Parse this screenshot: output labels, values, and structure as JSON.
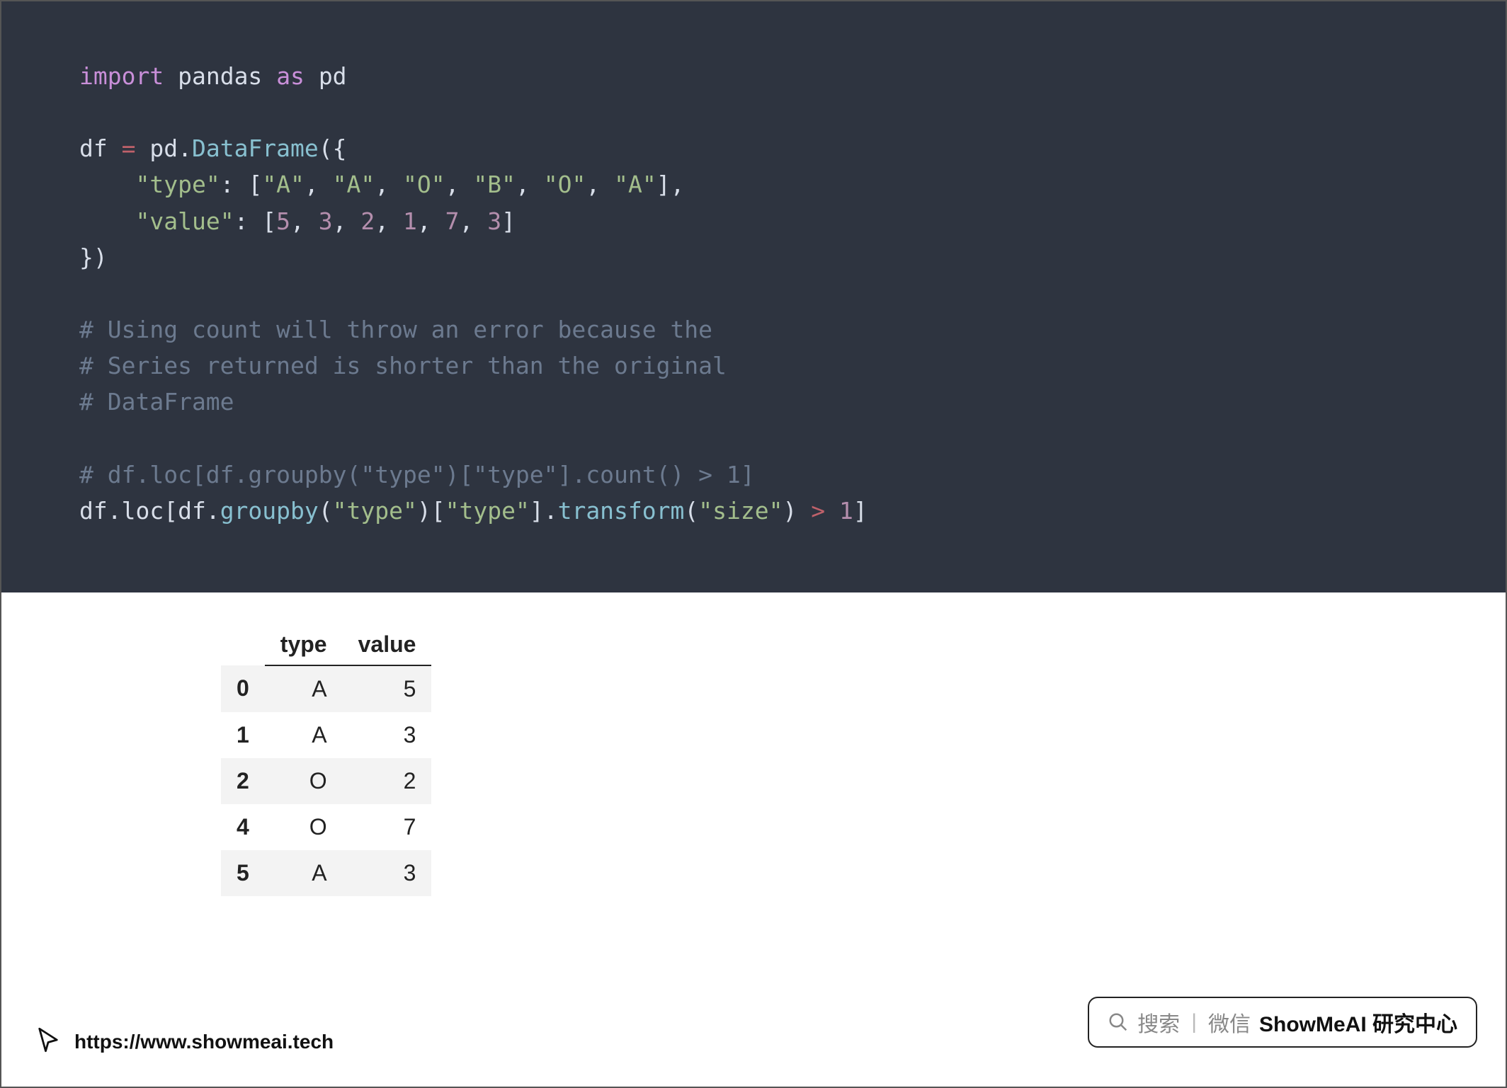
{
  "code": {
    "lines": [
      [
        [
          "import",
          "kw"
        ],
        [
          " ",
          "op"
        ],
        [
          "pandas",
          "attr"
        ],
        [
          " ",
          "op"
        ],
        [
          "as",
          "kw"
        ],
        [
          " ",
          "op"
        ],
        [
          "pd",
          "attr"
        ]
      ],
      [],
      [
        [
          "df ",
          "attr"
        ],
        [
          "=",
          "opred"
        ],
        [
          " pd.",
          "attr"
        ],
        [
          "DataFrame",
          "fn"
        ],
        [
          "({",
          "op"
        ]
      ],
      [
        [
          "    ",
          "op"
        ],
        [
          "\"type\"",
          "str"
        ],
        [
          ": [",
          "op"
        ],
        [
          "\"A\"",
          "str"
        ],
        [
          ", ",
          "op"
        ],
        [
          "\"A\"",
          "str"
        ],
        [
          ", ",
          "op"
        ],
        [
          "\"O\"",
          "str"
        ],
        [
          ", ",
          "op"
        ],
        [
          "\"B\"",
          "str"
        ],
        [
          ", ",
          "op"
        ],
        [
          "\"O\"",
          "str"
        ],
        [
          ", ",
          "op"
        ],
        [
          "\"A\"",
          "str"
        ],
        [
          "],",
          "op"
        ]
      ],
      [
        [
          "    ",
          "op"
        ],
        [
          "\"value\"",
          "str"
        ],
        [
          ": [",
          "op"
        ],
        [
          "5",
          "num"
        ],
        [
          ", ",
          "op"
        ],
        [
          "3",
          "num"
        ],
        [
          ", ",
          "op"
        ],
        [
          "2",
          "num"
        ],
        [
          ", ",
          "op"
        ],
        [
          "1",
          "num"
        ],
        [
          ", ",
          "op"
        ],
        [
          "7",
          "num"
        ],
        [
          ", ",
          "op"
        ],
        [
          "3",
          "num"
        ],
        [
          "]",
          "op"
        ]
      ],
      [
        [
          "})",
          "op"
        ]
      ],
      [],
      [
        [
          "# Using count will throw an error because the",
          "cmt"
        ]
      ],
      [
        [
          "# Series returned is shorter than the original",
          "cmt"
        ]
      ],
      [
        [
          "# DataFrame",
          "cmt"
        ]
      ],
      [],
      [
        [
          "# df.loc[df.groupby(\"type\")[\"type\"].count() > 1]",
          "cmt"
        ]
      ],
      [
        [
          "df.loc[df.",
          "attr"
        ],
        [
          "groupby",
          "fn"
        ],
        [
          "(",
          "op"
        ],
        [
          "\"type\"",
          "str"
        ],
        [
          ")[",
          "op"
        ],
        [
          "\"type\"",
          "str"
        ],
        [
          "].",
          "op"
        ],
        [
          "transform",
          "fn"
        ],
        [
          "(",
          "op"
        ],
        [
          "\"size\"",
          "str"
        ],
        [
          ") ",
          "op"
        ],
        [
          ">",
          "opred"
        ],
        [
          " ",
          "op"
        ],
        [
          "1",
          "num"
        ],
        [
          "]",
          "op"
        ]
      ]
    ]
  },
  "output_table": {
    "columns": [
      "type",
      "value"
    ],
    "rows": [
      {
        "index": "0",
        "type": "A",
        "value": "5"
      },
      {
        "index": "1",
        "type": "A",
        "value": "3"
      },
      {
        "index": "2",
        "type": "O",
        "value": "2"
      },
      {
        "index": "4",
        "type": "O",
        "value": "7"
      },
      {
        "index": "5",
        "type": "A",
        "value": "3"
      }
    ]
  },
  "footer": {
    "url": "https://www.showmeai.tech"
  },
  "search_widget": {
    "search_label": "搜索",
    "wechat_label": "微信",
    "brand": "ShowMeAI 研究中心"
  }
}
